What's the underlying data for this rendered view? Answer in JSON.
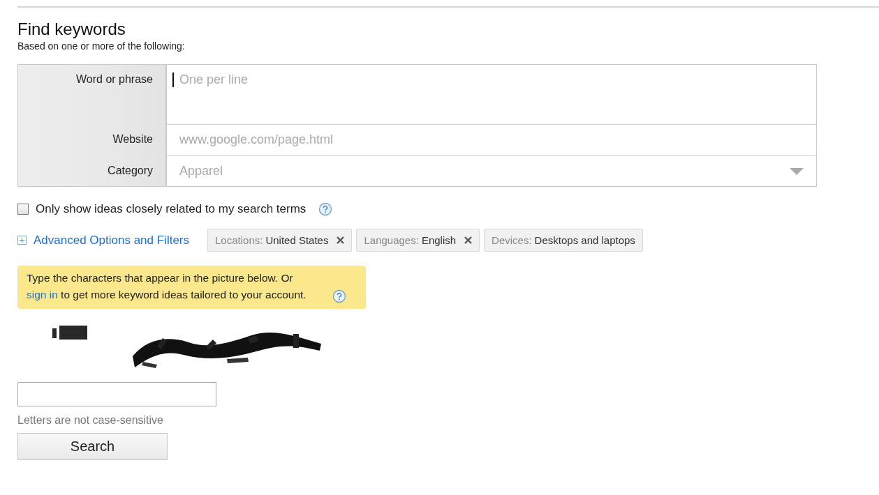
{
  "title": "Find keywords",
  "subtitle": "Based on one or more of the following:",
  "form": {
    "rows": [
      {
        "kind": "textarea",
        "label": "Word or phrase",
        "placeholder": "One per line",
        "focused": true
      },
      {
        "kind": "text",
        "label": "Website",
        "placeholder": "www.google.com/page.html"
      },
      {
        "kind": "select",
        "label": "Category",
        "placeholder": "Apparel"
      }
    ]
  },
  "related_only": {
    "label": "Only show ideas closely related to my search terms",
    "checked": false
  },
  "advanced": {
    "label": "Advanced Options and Filters",
    "expanded": false
  },
  "filters": [
    {
      "name": "Locations:",
      "value": "United States",
      "removable": true
    },
    {
      "name": "Languages:",
      "value": "English",
      "removable": true
    },
    {
      "name": "Devices:",
      "value": "Desktops and laptops",
      "removable": false
    }
  ],
  "notice": {
    "before": "Type the characters that appear in the picture below. Or ",
    "link": "sign in",
    "after": " to get more keyword ideas tailored to your account."
  },
  "captcha_hint": "Letters are not case-sensitive",
  "search_button": "Search"
}
